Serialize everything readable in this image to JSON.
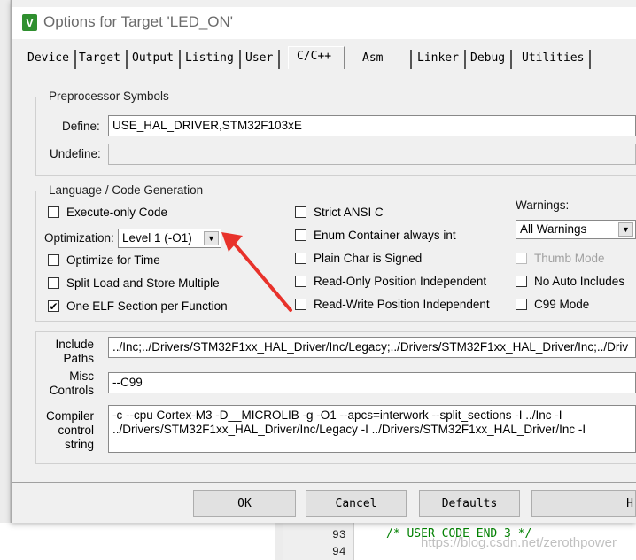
{
  "dialog": {
    "title": "Options for Target 'LED_ON'",
    "app_icon_letter": "V"
  },
  "tabs": [
    "Device",
    "Target",
    "Output",
    "Listing",
    "User",
    "C/C++",
    "Asm",
    "Linker",
    "Debug",
    "Utilities"
  ],
  "active_tab": "C/C++",
  "preprocessor": {
    "group_title": "Preprocessor Symbols",
    "define_label": "Define:",
    "define_value": "USE_HAL_DRIVER,STM32F103xE",
    "undefine_label": "Undefine:",
    "undefine_value": ""
  },
  "language": {
    "group_title": "Language / Code Generation",
    "execute_only_code": {
      "label": "Execute-only Code",
      "checked": false
    },
    "optimization_label": "Optimization:",
    "optimization_value": "Level 1 (-O1)",
    "optimize_for_time": {
      "label": "Optimize for Time",
      "checked": false
    },
    "split_load_store": {
      "label": "Split Load and Store Multiple",
      "checked": false
    },
    "one_elf_section": {
      "label": "One ELF Section per Function",
      "checked": true
    },
    "strict_ansi_c": {
      "label": "Strict ANSI C",
      "checked": false
    },
    "enum_container": {
      "label": "Enum Container always int",
      "checked": false
    },
    "plain_char_signed": {
      "label": "Plain Char is Signed",
      "checked": false
    },
    "ro_position_independent": {
      "label": "Read-Only Position Independent",
      "checked": false
    },
    "rw_position_independent": {
      "label": "Read-Write Position Independent",
      "checked": false
    },
    "warnings_label": "Warnings:",
    "warnings_value": "All Warnings",
    "thumb_mode": {
      "label": "Thumb Mode",
      "checked": false,
      "disabled": true
    },
    "no_auto_includes": {
      "label": "No Auto Includes",
      "checked": false
    },
    "c99_mode": {
      "label": "C99 Mode",
      "checked": false
    }
  },
  "paths": {
    "include_label_1": "Include",
    "include_label_2": "Paths",
    "include_value": "../Inc;../Drivers/STM32F1xx_HAL_Driver/Inc/Legacy;../Drivers/STM32F1xx_HAL_Driver/Inc;../Driv",
    "misc_label_1": "Misc",
    "misc_label_2": "Controls",
    "misc_value": "--C99",
    "compiler_label_1": "Compiler",
    "compiler_label_2": "control",
    "compiler_label_3": "string",
    "compiler_value": "-c --cpu Cortex-M3 -D__MICROLIB -g -O1 --apcs=interwork --split_sections -I ../Inc -I\n../Drivers/STM32F1xx_HAL_Driver/Inc/Legacy -I ../Drivers/STM32F1xx_HAL_Driver/Inc -I"
  },
  "buttons": {
    "ok": "OK",
    "cancel": "Cancel",
    "defaults": "Defaults",
    "help": "H"
  },
  "editor": {
    "line_93": "93",
    "line_94": "94",
    "code_93": "/* USER CODE END 3 */",
    "watermark": "https://blog.csdn.net/zerothpower"
  },
  "colors": {
    "annotation_arrow": "#e8322b",
    "icon_green": "#2f8f2f",
    "comment_green": "#008000"
  }
}
